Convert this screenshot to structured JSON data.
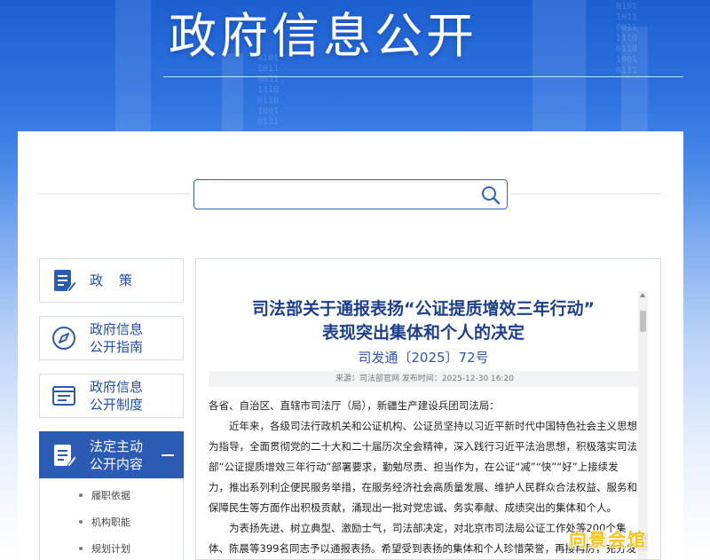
{
  "banner": {
    "title": "政府信息公开",
    "deco_text": "0101\n1011\n0011\n1110\n0110\n1001\n0111"
  },
  "search": {
    "placeholder": "",
    "value": "",
    "icon": "search-icon",
    "border_color": "#2e63c4"
  },
  "sidebar": {
    "items": [
      {
        "label": "政策",
        "icon": "document-edit-icon"
      },
      {
        "label": "政府信息公开指南",
        "icon": "compass-icon"
      },
      {
        "label": "政府信息公开制度",
        "icon": "list-window-icon"
      },
      {
        "label": "法定主动公开内容",
        "icon": "document-edit-icon",
        "active": true
      }
    ],
    "sub_items": [
      {
        "label": "履职依据"
      },
      {
        "label": "机构职能"
      },
      {
        "label": "规划计划"
      }
    ],
    "active_color": "#2c5bb3",
    "text_color": "#1f4fa3"
  },
  "article": {
    "title_line1": "司法部关于通报表扬“公证提质增效三年行动”",
    "title_line2": "表现突出集体和个人的决定",
    "doc_number": "司发通〔2025〕72号",
    "meta": "来源：司法部官网 发布时间：2025-12-30 16:20",
    "salutation": "各省、自治区、直辖市司法厅（局），新疆生产建设兵团司法局：",
    "para1": "近年来，各级司法行政机关和公证机构、公证员坚持以习近平新时代中国特色社会主义思想为指导，全面贯彻党的二十大和二十届历次全会精神，深入践行习近平法治思想，积极落实司法部“公证提质增效三年行动”部署要求，勤勉尽责、担当作为，在公证“减”“快”“好”上接续发力，推出系列利企便民服务举措，在服务经济社会高质量发展、维护人民群众合法权益、服务和保障民生等方面作出积极贡献，涌现出一批对党忠诚、务实奉献、成绩突出的集体和个人。",
    "para2": "为表扬先进、树立典型、激励士气，司法部决定，对北京市司法局公证工作处等200个集体、陈晨等399名同志予以通报表扬。希望受到表扬的集体和个人珍惜荣誉，再接再厉，充分发挥榜样的示"
  },
  "watermark": {
    "text": "向景会馆",
    "color": "#f3c317"
  },
  "colors": {
    "title_blue": "#1d3f8f",
    "accent": "#2e56b0"
  }
}
